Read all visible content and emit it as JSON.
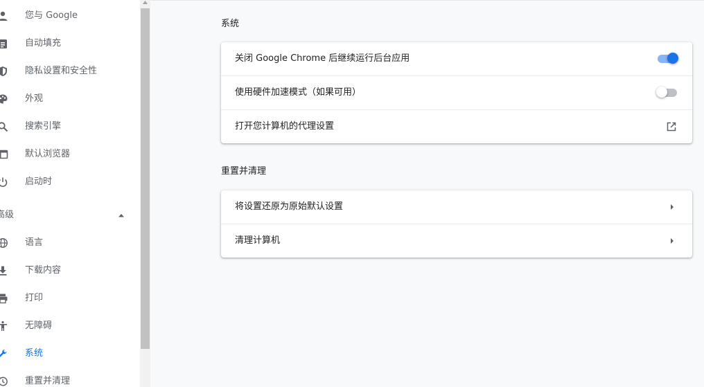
{
  "colors": {
    "accent": "#1a73e8",
    "text_primary": "#202124",
    "text_secondary": "#5f6368",
    "toggle_on_track": "#8ab4f8",
    "toggle_off_track": "#bdc1c6"
  },
  "sidebar": {
    "items": [
      {
        "label": "您与 Google",
        "icon": "person-icon"
      },
      {
        "label": "自动填充",
        "icon": "clipboard-icon"
      },
      {
        "label": "隐私设置和安全性",
        "icon": "shield-icon"
      },
      {
        "label": "外观",
        "icon": "palette-icon"
      },
      {
        "label": "搜索引擎",
        "icon": "search-icon"
      },
      {
        "label": "默认浏览器",
        "icon": "browser-icon"
      },
      {
        "label": "启动时",
        "icon": "power-icon"
      }
    ],
    "advanced_label": "高级",
    "advanced_items": [
      {
        "label": "语言",
        "icon": "globe-icon"
      },
      {
        "label": "下载内容",
        "icon": "download-icon"
      },
      {
        "label": "打印",
        "icon": "printer-icon"
      },
      {
        "label": "无障碍",
        "icon": "accessibility-icon"
      },
      {
        "label": "系统",
        "icon": "wrench-icon",
        "active": true
      },
      {
        "label": "重置并清理",
        "icon": "history-icon"
      }
    ]
  },
  "main": {
    "system": {
      "title": "系统",
      "rows": [
        {
          "label": "关闭 Google Chrome 后继续运行后台应用",
          "control": "toggle",
          "state": "on"
        },
        {
          "label": "使用硬件加速模式（如果可用）",
          "control": "toggle",
          "state": "off"
        },
        {
          "label": "打开您计算机的代理设置",
          "control": "external-link-icon"
        }
      ]
    },
    "reset": {
      "title": "重置并清理",
      "rows": [
        {
          "label": "将设置还原为原始默认设置",
          "control": "chevron-right-icon"
        },
        {
          "label": "清理计算机",
          "control": "chevron-right-icon"
        }
      ]
    }
  }
}
